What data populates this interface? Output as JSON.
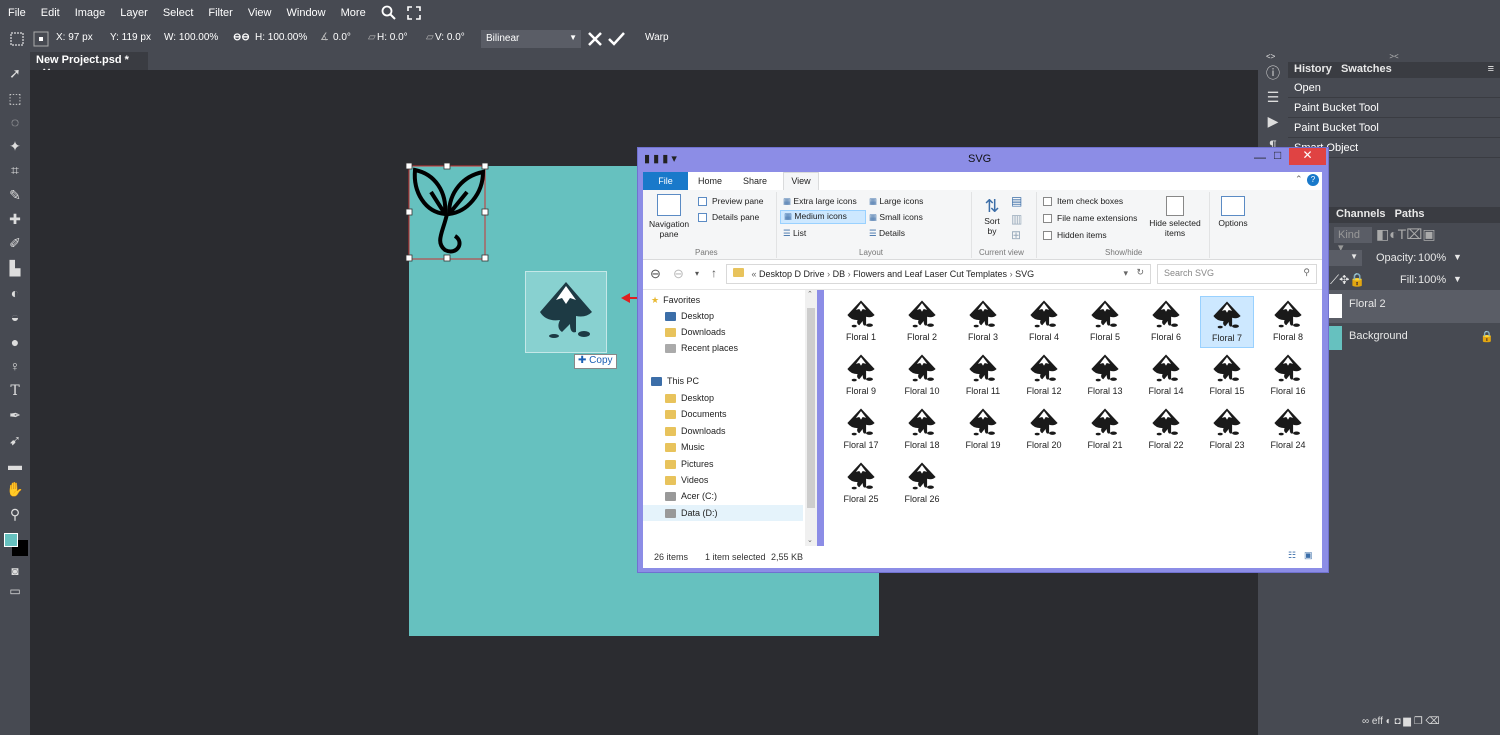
{
  "menu": [
    "File",
    "Edit",
    "Image",
    "Layer",
    "Select",
    "Filter",
    "View",
    "Window",
    "More"
  ],
  "options": {
    "x": "X: 97 px",
    "y": "Y: 119 px",
    "w": "W: 100.00%",
    "h": "H: 100.00%",
    "angle": "0.0°",
    "hskew": "H: 0.0°",
    "vskew": "V: 0.0°",
    "interp": "Bilinear",
    "warp": "Warp"
  },
  "doc_tab": "New Project.psd *",
  "right_panel": {
    "tabs": [
      "History",
      "Swatches"
    ],
    "history": [
      "Open",
      "Paint Bucket Tool",
      "Paint Bucket Tool",
      "Smart Object"
    ],
    "layers_tabs": [
      "Channels",
      "Paths"
    ],
    "kind": "Kind",
    "opacity_label": "Opacity:",
    "opacity": "100%",
    "fill_label": "Fill:",
    "fill": "100%",
    "layers": [
      "Floral 2",
      "Background"
    ],
    "bottom_off": "eff"
  },
  "drag": {
    "copy_label": "Copy"
  },
  "colors": {
    "canvas": "#66c1bf",
    "explorer_frame": "#8c8de6",
    "close_red": "#e04343",
    "ribbon_file": "#1979ca"
  },
  "explorer": {
    "title": "SVG",
    "tabs": [
      "File",
      "Home",
      "Share",
      "View"
    ],
    "ribbon": {
      "navigation_pane": "Navigation pane",
      "preview_pane": "Preview pane",
      "details_pane": "Details pane",
      "panes_label": "Panes",
      "layouts": [
        "Extra large icons",
        "Large icons",
        "Medium icons",
        "Small icons",
        "List",
        "Details"
      ],
      "layout_label": "Layout",
      "sort_by": "Sort by",
      "current_view_label": "Current view",
      "checks": [
        "Item check boxes",
        "File name extensions",
        "Hidden items"
      ],
      "hide_selected": "Hide selected items",
      "options": "Options",
      "showhide_label": "Show/hide"
    },
    "path": [
      "Desktop D Drive",
      "DB",
      "Flowers and Leaf Laser Cut Templates",
      "SVG"
    ],
    "search_placeholder": "Search SVG",
    "nav": {
      "favorites": "Favorites",
      "fav_items": [
        "Desktop",
        "Downloads",
        "Recent places"
      ],
      "thispc": "This PC",
      "pc_items": [
        "Desktop",
        "Documents",
        "Downloads",
        "Music",
        "Pictures",
        "Videos",
        "Acer (C:)",
        "Data (D:)"
      ]
    },
    "files": [
      "Floral 1",
      "Floral 2",
      "Floral 3",
      "Floral 4",
      "Floral 5",
      "Floral 6",
      "Floral 7",
      "Floral 8",
      "Floral 9",
      "Floral 10",
      "Floral 11",
      "Floral 12",
      "Floral 13",
      "Floral 14",
      "Floral 15",
      "Floral 16",
      "Floral 17",
      "Floral 18",
      "Floral 19",
      "Floral 20",
      "Floral 21",
      "Floral 22",
      "Floral 23",
      "Floral 24",
      "Floral 25",
      "Floral 26"
    ],
    "selected_index": 6,
    "status_count": "26 items",
    "status_selected": "1 item selected",
    "status_size": "2,55 KB"
  }
}
